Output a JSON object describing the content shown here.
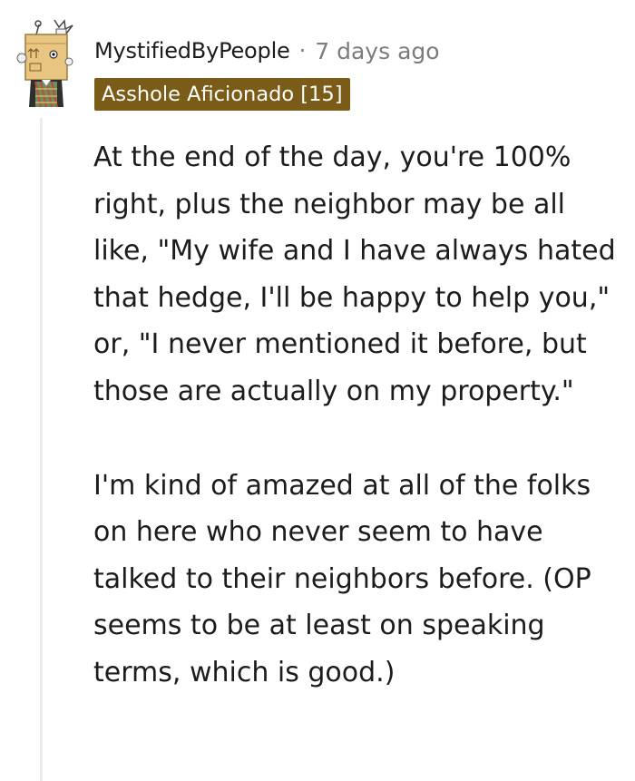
{
  "comment": {
    "username": "MystifiedByPeople",
    "separator": "·",
    "timestamp": "7 days ago",
    "flair": "Asshole Aficionado [15]",
    "avatar": "robot-box-avatar-icon",
    "paragraphs": [
      "At the end of the day, you're 100% right, plus the neighbor may be all like, \"My wife and I have always hated that hedge, I'll be happy to help you,\" or, \"I never mentioned it before, but those are actually on my property.\"",
      "I'm kind of amazed at all of the folks on here who never seem to have talked to their neighbors before. (OP seems to be at least on speaking terms, which is good.)"
    ]
  },
  "colors": {
    "flair_background": "#7a5b17",
    "flair_text": "#ffffff",
    "text": "#1c1c1c",
    "meta": "#7c7c7c",
    "thread_line": "#ececec"
  }
}
